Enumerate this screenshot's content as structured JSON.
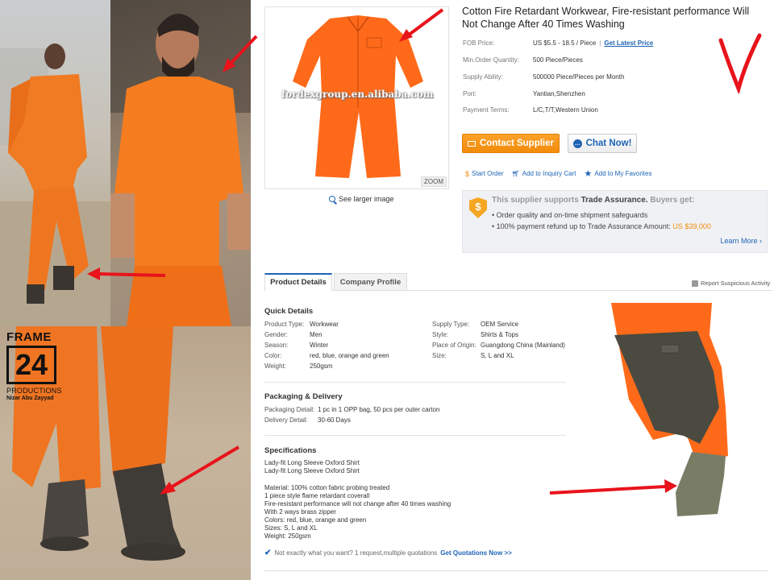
{
  "watermark": {
    "line1": "FRAME",
    "number": "24",
    "line2": "PRODUCTIONS",
    "author": "Nizar Abu Zayyad"
  },
  "product": {
    "image_watermark": "fordexgroup.en.alibaba.com",
    "zoom_label": "ZOOM",
    "see_larger": "See larger image",
    "title": "Cotton Fire Retardant Workwear, Fire-resistant performance Will Not Change After 40 Times Washing"
  },
  "specs": [
    {
      "key": "FOB Price:",
      "value": "US $5.5 - 18.5 / Piece",
      "link": "Get Latest Price"
    },
    {
      "key": "Min.Order Quantity:",
      "value": "500 Piece/Pieces"
    },
    {
      "key": "Supply Ability:",
      "value": "500000 Piece/Pieces per Month"
    },
    {
      "key": "Port:",
      "value": "Yantian,Shenzhen"
    },
    {
      "key": "Payment Terms:",
      "value": "L/C,T/T,Western Union"
    }
  ],
  "actions": {
    "contact_label": "Contact Supplier",
    "chat_label": "Chat Now!",
    "start_order": "Start Order",
    "add_inquiry": "Add to Inquiry Cart",
    "add_favorites": "Add to My Favorites"
  },
  "trade_assurance": {
    "head_prefix": "This supplier supports",
    "head_bold": "Trade Assurance.",
    "head_suffix": "Buyers get:",
    "item1": "Order quality and on-time shipment safeguards",
    "item2_prefix": "100% payment refund up to Trade Assurance Amount:",
    "item2_amount": "US $39,000",
    "more": "Learn More"
  },
  "tabs": {
    "details": "Product Details",
    "profile": "Company Profile",
    "report": "Report Suspicious Activity"
  },
  "quick_details": {
    "title": "Quick Details",
    "left": [
      {
        "k": "Product Type:",
        "v": "Workwear"
      },
      {
        "k": "Gender:",
        "v": "Men"
      },
      {
        "k": "Season:",
        "v": "Winter"
      },
      {
        "k": "Color:",
        "v": "red, blue, orange and green"
      },
      {
        "k": "Weight:",
        "v": "250gsm"
      }
    ],
    "right": [
      {
        "k": "Supply Type:",
        "v": "OEM Service"
      },
      {
        "k": "Style:",
        "v": "Shirts & Tops"
      },
      {
        "k": "Place of Origin:",
        "v": "Guangdong China (Mainland)"
      },
      {
        "k": "Size:",
        "v": "S, L and XL"
      }
    ]
  },
  "packaging": {
    "title": "Packaging & Delivery",
    "rows": [
      {
        "k": "Packaging Detail:",
        "v": "1 pc in 1 OPP bag, 50 pcs per outer carton"
      },
      {
        "k": "Delivery Detail:",
        "v": "30-60 Days"
      }
    ]
  },
  "specifications": {
    "title": "Specifications",
    "lines": [
      "Lady-fit Long Sleeve Oxford Shirt",
      "Lady-fit Long Sleeve Oxford Shirt",
      "",
      "Material: 100% cotton fabric probing treated",
      "1 piece style flame retardant coverall",
      "Fire-resistant performance will not change after 40 times washing",
      "With 2 ways brass zipper",
      "Colors: red, blue, orange and green",
      "Sizes: S, L and XL",
      "Weight: 250gsm"
    ]
  },
  "quotation": {
    "text": "Not exactly what you want? 1 request,multiple quotations",
    "link": "Get Quotations Now >>"
  },
  "colors": {
    "orange": "#f28c0a",
    "link_blue": "#1e64b4",
    "annotation_red": "#e8131b",
    "coverall_orange": "#ff6a1a"
  }
}
